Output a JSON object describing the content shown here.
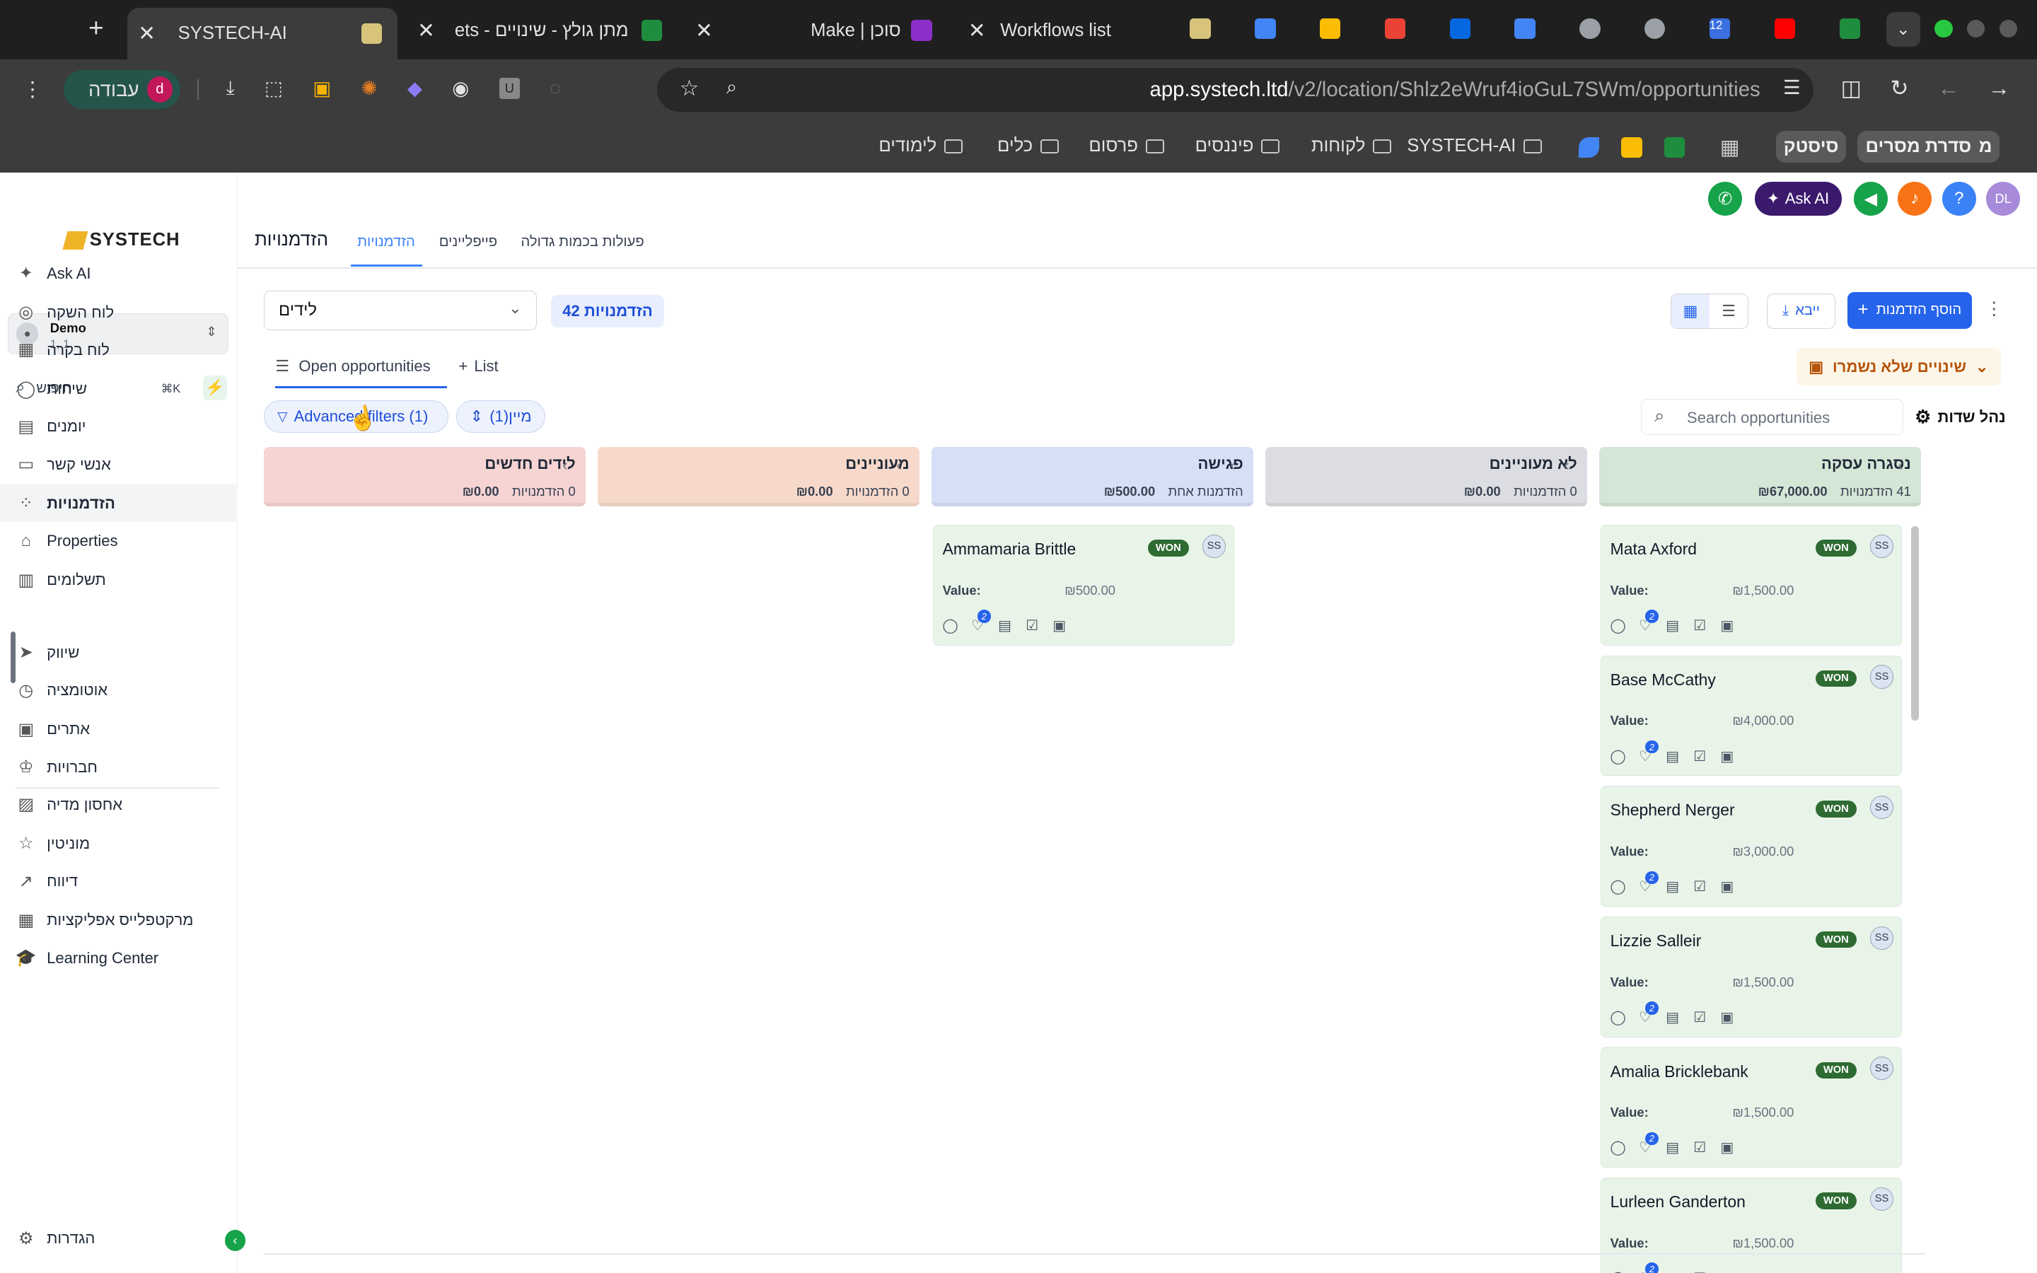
{
  "browser": {
    "tabs": [
      {
        "title": "SYSTECH-AI",
        "active": true
      },
      {
        "title": "מתן גולץ - שינויים - ets"
      },
      {
        "title": "Make | סוכן"
      },
      {
        "title": "Workflows list"
      }
    ],
    "url_host": "app.systech.ltd",
    "url_path": "/v2/location/Shlz2eWruf4ioGuL7SWm/opportunities",
    "profile_label": "עבודה",
    "profile_initial": "d",
    "pinned_badge": "12",
    "bookmarks": [
      "מתן",
      "סדרת מסרים",
      "סיסטק",
      "SYSTECH-AI",
      "לקוחות",
      "פיננסים",
      "פרסום",
      "כלים",
      "לימודים"
    ]
  },
  "brand": {
    "logo_text": "SYSTECH"
  },
  "account": {
    "name": "Demo",
    "sub": "1, 1"
  },
  "search": {
    "label": "חיפוש",
    "shortcut": "⌘K"
  },
  "nav": [
    {
      "label": "Ask AI",
      "icon": "sparkle-icon"
    },
    {
      "label": "לוח השקה",
      "icon": "rocket-icon"
    },
    {
      "label": "לוח בקרה",
      "icon": "grid-icon"
    },
    {
      "label": "שיחות",
      "icon": "chat-icon"
    },
    {
      "label": "יומנים",
      "icon": "calendar-icon"
    },
    {
      "label": "אנשי קשר",
      "icon": "contacts-icon"
    },
    {
      "label": "הזדמנויות",
      "icon": "opportunities-icon",
      "selected": true
    },
    {
      "label": "Properties",
      "icon": "home-icon"
    },
    {
      "label": "תשלומים",
      "icon": "payments-icon"
    },
    {
      "label": "שיווק",
      "icon": "send-icon"
    },
    {
      "label": "אוטומציה",
      "icon": "automation-icon"
    },
    {
      "label": "אתרים",
      "icon": "sites-icon"
    },
    {
      "label": "חברויות",
      "icon": "membership-icon"
    },
    {
      "label": "אחסון מדיה",
      "icon": "media-icon"
    },
    {
      "label": "מוניטין",
      "icon": "star-icon"
    },
    {
      "label": "דיווח",
      "icon": "chart-icon"
    },
    {
      "label": "מרקטפלייס אפליקציות",
      "icon": "apps-icon"
    },
    {
      "label": "Learning Center",
      "icon": "graduation-icon"
    }
  ],
  "settings_label": "הגדרות",
  "header": {
    "page_title": "הזדמנויות",
    "tabs": [
      "הזדמנויות",
      "פייפליינים",
      "פעולות בכמות גדולה"
    ],
    "ask_ai": "Ask AI",
    "user_initials": "DL"
  },
  "toolbar": {
    "pipeline": "לידים",
    "count_label": "42 הזדמנויות",
    "add_button": "הוסף הזדמנות",
    "import_button": "ייבא",
    "unsaved": "שינויים שלא נשמרו",
    "view_tab": "Open opportunities",
    "list_tab": "List",
    "adv_filters": "Advanced filters (1)",
    "sort": "מיין(1)",
    "search_placeholder": "Search opportunities",
    "manage_fields": "נהל שדות"
  },
  "stages": [
    {
      "name": "לידים חדשים",
      "count": "0 הזדמנויות",
      "amount": "₪0.00",
      "color": "#f6d4d4"
    },
    {
      "name": "מעוניינים",
      "count": "0 הזדמנויות",
      "amount": "₪0.00",
      "color": "#f7d9cc"
    },
    {
      "name": "פגישה",
      "count": "הזדמנות אחת",
      "amount": "₪500.00",
      "color": "#d6dff6"
    },
    {
      "name": "לא מעוניינים",
      "count": "0 הזדמנויות",
      "amount": "₪0.00",
      "color": "#dcdde2"
    },
    {
      "name": "נסגרה עסקה",
      "count": "41 הזדמנויות",
      "amount": "₪67,000.00",
      "color": "#d4e6d6"
    }
  ],
  "cards": [
    {
      "name": "Ammamaria Brittle",
      "value": "₪500.00",
      "status": "WON",
      "owner": "SS",
      "stage": 2
    },
    {
      "name": "Mata Axford",
      "value": "₪1,500.00",
      "status": "WON",
      "owner": "SS",
      "stage": 4
    },
    {
      "name": "Base McCathy",
      "value": "₪4,000.00",
      "status": "WON",
      "owner": "SS",
      "stage": 4
    },
    {
      "name": "Shepherd Nerger",
      "value": "₪3,000.00",
      "status": "WON",
      "owner": "SS",
      "stage": 4
    },
    {
      "name": "Lizzie Salleir",
      "value": "₪1,500.00",
      "status": "WON",
      "owner": "SS",
      "stage": 4
    },
    {
      "name": "Amalia Bricklebank",
      "value": "₪1,500.00",
      "status": "WON",
      "owner": "SS",
      "stage": 4
    },
    {
      "name": "Lurleen Ganderton",
      "value": "₪1,500.00",
      "status": "WON",
      "owner": "SS",
      "stage": 4
    }
  ],
  "value_label": "Value:",
  "notif_badge": "2"
}
